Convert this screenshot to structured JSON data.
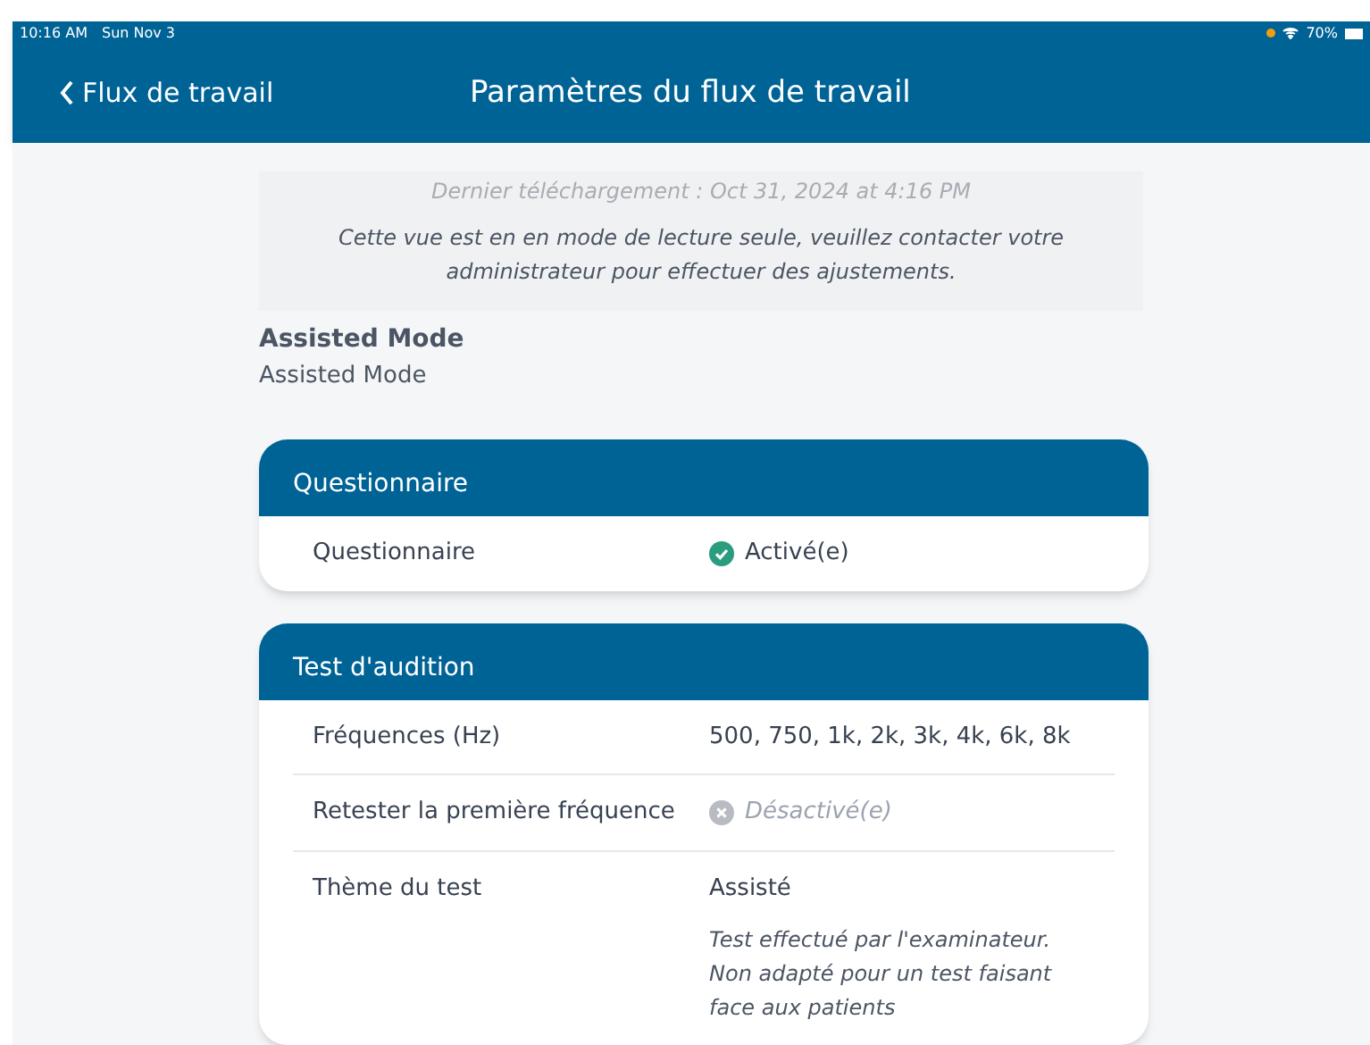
{
  "status_bar": {
    "time": "10:16 AM",
    "date": "Sun Nov 3",
    "battery": "70%"
  },
  "nav": {
    "back": "Flux de travail",
    "title": "Paramètres du flux de travail"
  },
  "notice": {
    "last_download": "Dernier téléchargement : Oct 31, 2024 at 4:16 PM",
    "message": "Cette vue est en en mode de lecture seule, veuillez contacter votre administrateur pour effectuer des ajustements."
  },
  "mode": {
    "title": "Assisted Mode",
    "value": "Assisted Mode"
  },
  "sections": [
    {
      "title": "Questionnaire",
      "rows": [
        {
          "kind": "toggle",
          "label": "Questionnaire",
          "on": true,
          "value": "Activé(e)"
        }
      ]
    },
    {
      "title": "Test d'audition",
      "rows": [
        {
          "kind": "text",
          "label": "Fréquences (Hz)",
          "value": "500, 750, 1k, 2k, 3k, 4k, 6k, 8k"
        },
        {
          "kind": "toggle",
          "label": "Retester la première fréquence",
          "on": false,
          "value": "Désactivé(e)"
        },
        {
          "kind": "text",
          "label": "Thème du test",
          "value": "Assisté",
          "note": "Test effectué par l'examinateur. Non adapté pour un test faisant face aux patients"
        }
      ]
    }
  ]
}
